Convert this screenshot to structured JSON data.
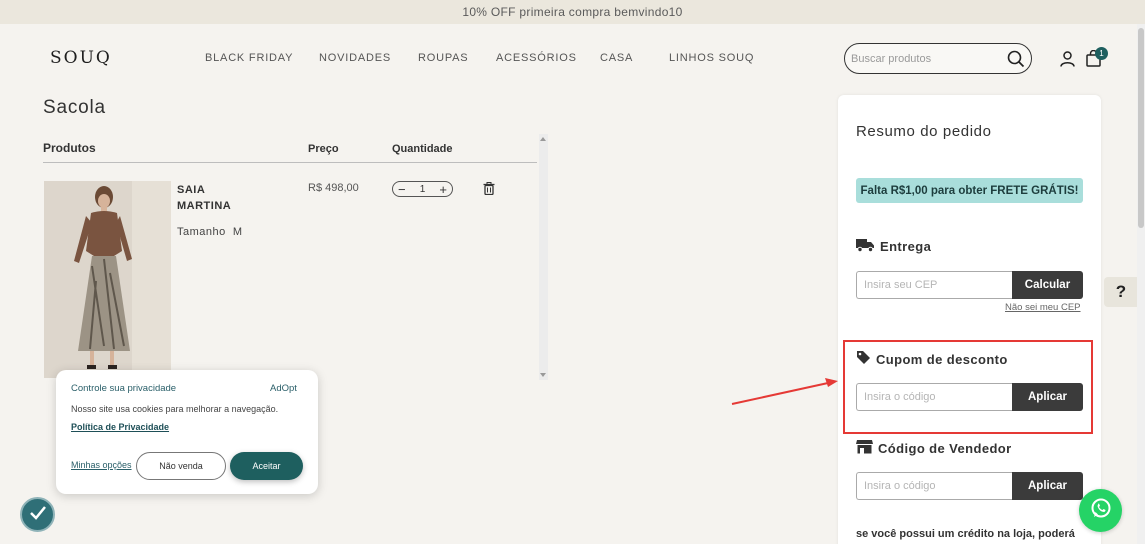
{
  "promo_bar": {
    "text": "10% OFF primeira compra bemvindo10"
  },
  "header": {
    "logo": "SOUQ",
    "nav": [
      "BLACK FRIDAY",
      "NOVIDADES",
      "ROUPAS",
      "ACESSÓRIOS",
      "CASA",
      "LINHOS SOUQ"
    ],
    "search_placeholder": "Buscar produtos",
    "cart_count": "1",
    "icons": {
      "search": "search-icon",
      "user": "user-icon",
      "cart": "shopping-bag-icon"
    }
  },
  "cart": {
    "title": "Sacola",
    "columns": {
      "product": "Produtos",
      "price": "Preço",
      "quantity": "Quantidade"
    },
    "items": [
      {
        "name": "SAIA MARTINA",
        "size_label": "Tamanho",
        "size": "M",
        "price": "R$ 498,00",
        "quantity": "1",
        "minus": "−",
        "plus": "+"
      }
    ]
  },
  "cookie_banner": {
    "title": "Controle sua privacidade",
    "brand": "AdOpt",
    "message": "Nosso site usa cookies para melhorar a navegação.",
    "policy_link": "Política de Privacidade",
    "options_link": "Minhas opções",
    "decline_label": "Não venda",
    "accept_label": "Aceitar"
  },
  "summary": {
    "title": "Resumo do pedido",
    "free_shipping_msg": "Falta R$1,00 para obter FRETE GRÁTIS!",
    "delivery": {
      "heading": "Entrega",
      "placeholder": "Insira seu CEP",
      "button": "Calcular",
      "help_link": "Não sei meu CEP"
    },
    "coupon": {
      "heading": "Cupom de desconto",
      "placeholder": "Insira o código",
      "button": "Aplicar"
    },
    "seller": {
      "heading": "Código de Vendedor",
      "placeholder": "Insira o código",
      "button": "Aplicar"
    },
    "credit_note": "se você possui um crédito na loja, poderá"
  },
  "help_button": "?",
  "colors": {
    "accent": "#1e5f5f",
    "shipping_banner": "#a9dedb",
    "whatsapp": "#25d366",
    "highlight": "#e53935"
  }
}
